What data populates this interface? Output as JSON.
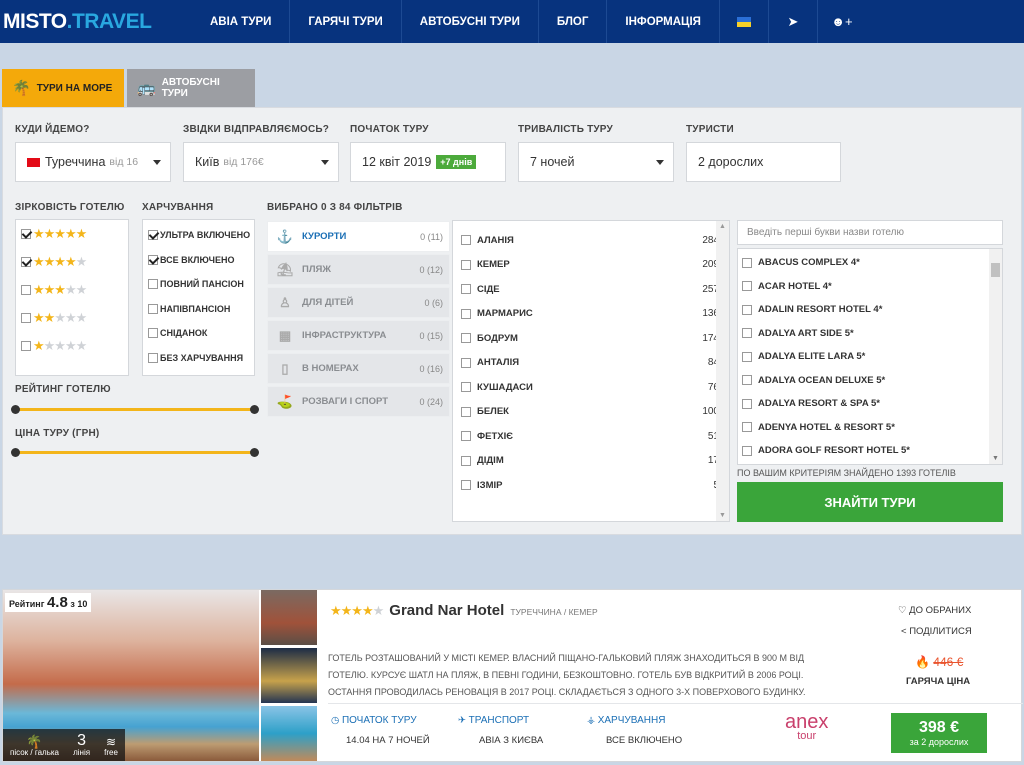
{
  "header": {
    "logo_part1": "MISTO",
    "logo_part2": ".TRAVEL",
    "nav": [
      "АВІА ТУРИ",
      "ГАРЯЧІ ТУРИ",
      "АВТОБУСНІ ТУРИ",
      "БЛОГ",
      "ІНФОРМАЦІЯ"
    ]
  },
  "tabs": {
    "sea": "ТУРИ НА МОРЕ",
    "bus": "АВТОБУСНІ ТУРИ"
  },
  "search": {
    "where_label": "КУДИ ЙДЕМО?",
    "where_value": "Туреччина",
    "where_from": "від 16",
    "from_label": "ЗВІДКИ ВІДПРАВЛЯЄМОСЬ?",
    "from_value": "Київ",
    "from_price": "від 176€",
    "start_label": "ПОЧАТОК ТУРУ",
    "start_value": "12 квіт 2019",
    "start_badge": "+7 днів",
    "duration_label": "ТРИВАЛІСТЬ ТУРУ",
    "duration_value": "7 ночей",
    "tourists_label": "ТУРИСТИ",
    "tourists_value": "2 дорослих"
  },
  "filters": {
    "stars_label": "ЗІРКОВІСТЬ ГОТЕЛЮ",
    "stars": [
      {
        "n": 5,
        "checked": true
      },
      {
        "n": 4,
        "checked": true
      },
      {
        "n": 3,
        "checked": false
      },
      {
        "n": 2,
        "checked": false
      },
      {
        "n": 1,
        "checked": false
      }
    ],
    "food_label": "ХАРЧУВАННЯ",
    "food": [
      {
        "label": "УЛЬТРА ВКЛЮЧЕНО",
        "checked": true
      },
      {
        "label": "ВСЕ ВКЛЮЧЕНО",
        "checked": true
      },
      {
        "label": "ПОВНИЙ ПАНСІОН",
        "checked": false
      },
      {
        "label": "НАПІВПАНСІОН",
        "checked": false
      },
      {
        "label": "СНІДАНОК",
        "checked": false
      },
      {
        "label": "БЕЗ ХАРЧУВАННЯ",
        "checked": false
      }
    ],
    "rating_label": "РЕЙТИНГ ГОТЕЛЮ",
    "price_label": "ЦІНА ТУРУ (ГРН)",
    "selected_label": "ВИБРАНО 0 З 84 ФІЛЬТРІВ",
    "categories": [
      {
        "label": "КУРОРТИ",
        "count": "0 (11)",
        "icon": "anchor-icon"
      },
      {
        "label": "ПЛЯЖ",
        "count": "0 (12)",
        "icon": "beach-icon"
      },
      {
        "label": "ДЛЯ ДІТЕЙ",
        "count": "0 (6)",
        "icon": "kids-icon"
      },
      {
        "label": "ІНФРАСТРУКТУРА",
        "count": "0 (15)",
        "icon": "building-icon"
      },
      {
        "label": "В НОМЕРАХ",
        "count": "0 (16)",
        "icon": "room-icon"
      },
      {
        "label": "РОЗВАГИ І СПОРТ",
        "count": "0 (24)",
        "icon": "golf-icon"
      }
    ],
    "resorts": [
      {
        "name": "АЛАНІЯ",
        "n": "284"
      },
      {
        "name": "КЕМЕР",
        "n": "209"
      },
      {
        "name": "СІДЕ",
        "n": "257"
      },
      {
        "name": "МАРМАРИС",
        "n": "136"
      },
      {
        "name": "БОДРУМ",
        "n": "174"
      },
      {
        "name": "АНТАЛІЯ",
        "n": "84"
      },
      {
        "name": "КУШАДАСИ",
        "n": "76"
      },
      {
        "name": "БЕЛЕК",
        "n": "100"
      },
      {
        "name": "ФЕТХІЄ",
        "n": "51"
      },
      {
        "name": "ДІДІМ",
        "n": "17"
      },
      {
        "name": "ІЗМІР",
        "n": "5"
      }
    ],
    "hotel_search_placeholder": "Введіть перші букви назви готелю",
    "hotels": [
      "ABACUS COMPLEX 4*",
      "ACAR HOTEL 4*",
      "ADALIN RESORT HOTEL 4*",
      "ADALYA ART SIDE 5*",
      "ADALYA ELITE LARA 5*",
      "ADALYA OCEAN DELUXE 5*",
      "ADALYA RESORT & SPA 5*",
      "ADENYA HOTEL & RESORT 5*",
      "ADORA GOLF RESORT HOTEL 5*"
    ],
    "found_text": "ПО ВАШИМ КРИТЕРІЯМ ЗНАЙДЕНО 1393 ГОТЕЛІВ",
    "find_button": "ЗНАЙТИ ТУРИ"
  },
  "result": {
    "rating_prefix": "Рейтинг",
    "rating_value": "4.8",
    "rating_suffix": "з 10",
    "amenities": [
      {
        "icon": "beach-icon",
        "label": "пісок / галька"
      },
      {
        "icon": "line-number",
        "label": "лінія",
        "value": "3"
      },
      {
        "icon": "wifi-icon",
        "label": "free"
      }
    ],
    "stars": 4,
    "hotel_name": "Grand Nar Hotel",
    "location": "ТУРЕЧЧИНА / КЕМЕР",
    "description": "ГОТЕЛЬ РОЗТАШОВАНИЙ У МІСТІ КЕМЕР. ВЛАСНИЙ ПІЩАНО-ГАЛЬКОВИЙ ПЛЯЖ ЗНАХОДИТЬСЯ В 900 М ВІД ГОТЕЛЮ. КУРСУЄ ШАТЛ НА ПЛЯЖ, В ПЕВНІ ГОДИНИ, БЕЗКОШТОВНО. ГОТЕЛЬ БУВ ВІДКРИТИЙ В 2006 РОЦІ. ОСТАННЯ ПРОВОДИЛАСЬ РЕНОВАЦІЯ В 2017 РОЦІ. СКЛАДАЄТЬСЯ З ОДНОГО 3-Х ПОВЕРХОВОГО БУДИНКУ.",
    "favorites": "ДО ОБРАНИХ",
    "share": "ПОДІЛИТИСЯ",
    "old_price": "446 €",
    "hot_label": "ГАРЯЧА ЦІНА",
    "start_label": "ПОЧАТОК ТУРУ",
    "start_value": "14.04 НА 7 НОЧЕЙ",
    "transport_label": "ТРАНСПОРТ",
    "transport_value": "АВІА З КИЄВА",
    "food_label": "ХАРЧУВАННЯ",
    "food_value": "ВСЕ ВКЛЮЧЕНО",
    "operator_part1": "anex",
    "operator_part2": "tour",
    "price": "398 €",
    "price_for": "за 2 дорослих"
  },
  "colors": {
    "nav": "#07337e",
    "accent": "#f4a90a",
    "green": "#3aa53a",
    "link": "#1b6fb5",
    "hot": "#e9532d"
  }
}
